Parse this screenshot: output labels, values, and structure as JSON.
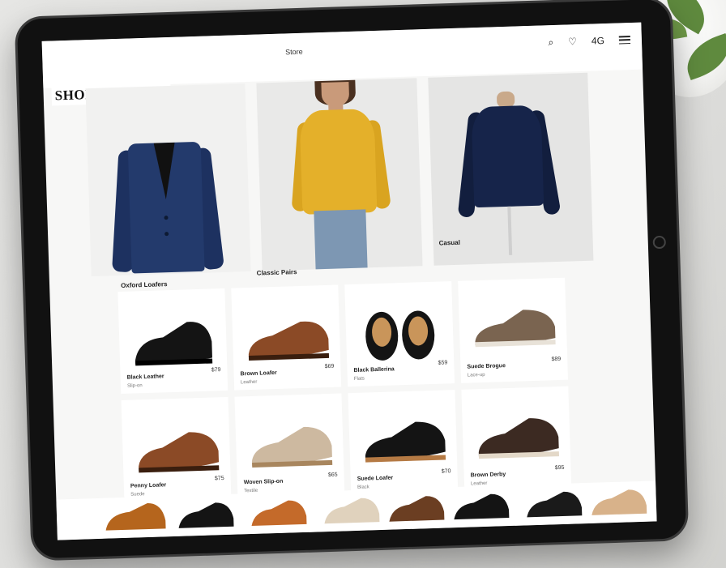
{
  "app": {
    "title": "Store",
    "brand": "SHOE FACTORY",
    "status_text": "4G"
  },
  "sections": {
    "featured": "Casual",
    "row1_heading_left": "Oxford Loafers",
    "row1_heading_mid": "Classic Pairs"
  },
  "products_row1": [
    {
      "name": "Black Leather",
      "price": "$79",
      "sub": "Slip-on"
    },
    {
      "name": "Brown Loafer",
      "price": "$69",
      "sub": "Leather"
    },
    {
      "name": "Black Ballerina",
      "price": "$59",
      "sub": "Flats"
    },
    {
      "name": "Suede Brogue",
      "price": "$89",
      "sub": "Lace-up"
    }
  ],
  "products_row2": [
    {
      "name": "Penny Loafer",
      "price": "$75",
      "sub": "Suede"
    },
    {
      "name": "Woven Slip-on",
      "price": "$65",
      "sub": "Textile"
    },
    {
      "name": "Suede Loafer",
      "price": "$70",
      "sub": "Black"
    },
    {
      "name": "Brown Derby",
      "price": "$95",
      "sub": "Leather"
    }
  ],
  "colors": {
    "navy": "#233a6c",
    "mustard": "#e4b02a",
    "cognac": "#8b4a26",
    "black": "#141414",
    "taupe": "#7a6450"
  }
}
